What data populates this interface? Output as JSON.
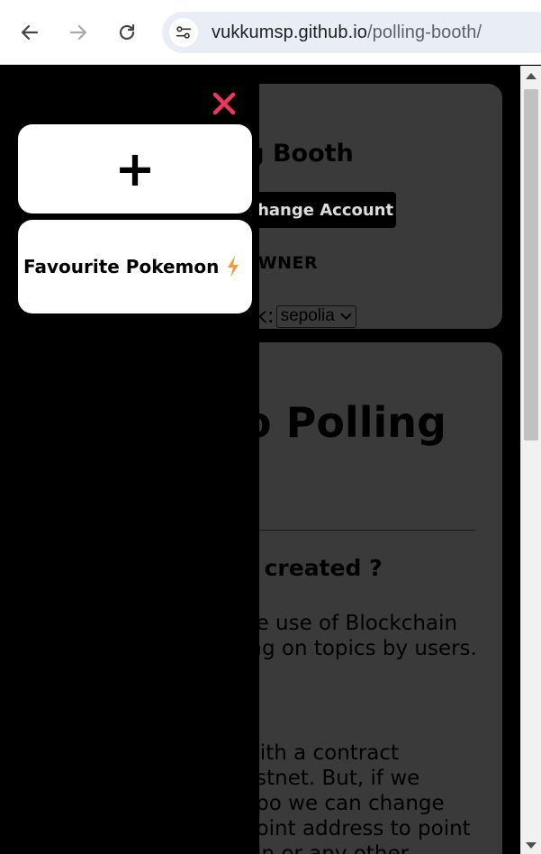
{
  "browser": {
    "url_host": "vukkumsp.github.io",
    "url_path": "/polling-booth/"
  },
  "header_card": {
    "title": "ng Booth",
    "change_account_label": "Change Account",
    "role": "OWNER",
    "network_label": "ork:",
    "network_value": "sepolia"
  },
  "main_card": {
    "hero": "o Polling",
    "why_heading": "s created ?",
    "para1": [
      "he use of Blockchain",
      "ing on topics by users."
    ],
    "para2": [
      "with a contract",
      "estnet. But, if we",
      "epo we can change",
      "point address to point",
      "ain or any other"
    ]
  },
  "sidebar": {
    "add_label": "+",
    "poll_title": "Favourite Pokemon",
    "poll_icon": "lightning-icon",
    "close_icon": "close-icon"
  },
  "colors": {
    "card_bg": "#3a3a3a",
    "close_red": "#f0365a",
    "lightning_orange": "#f39a3c"
  }
}
